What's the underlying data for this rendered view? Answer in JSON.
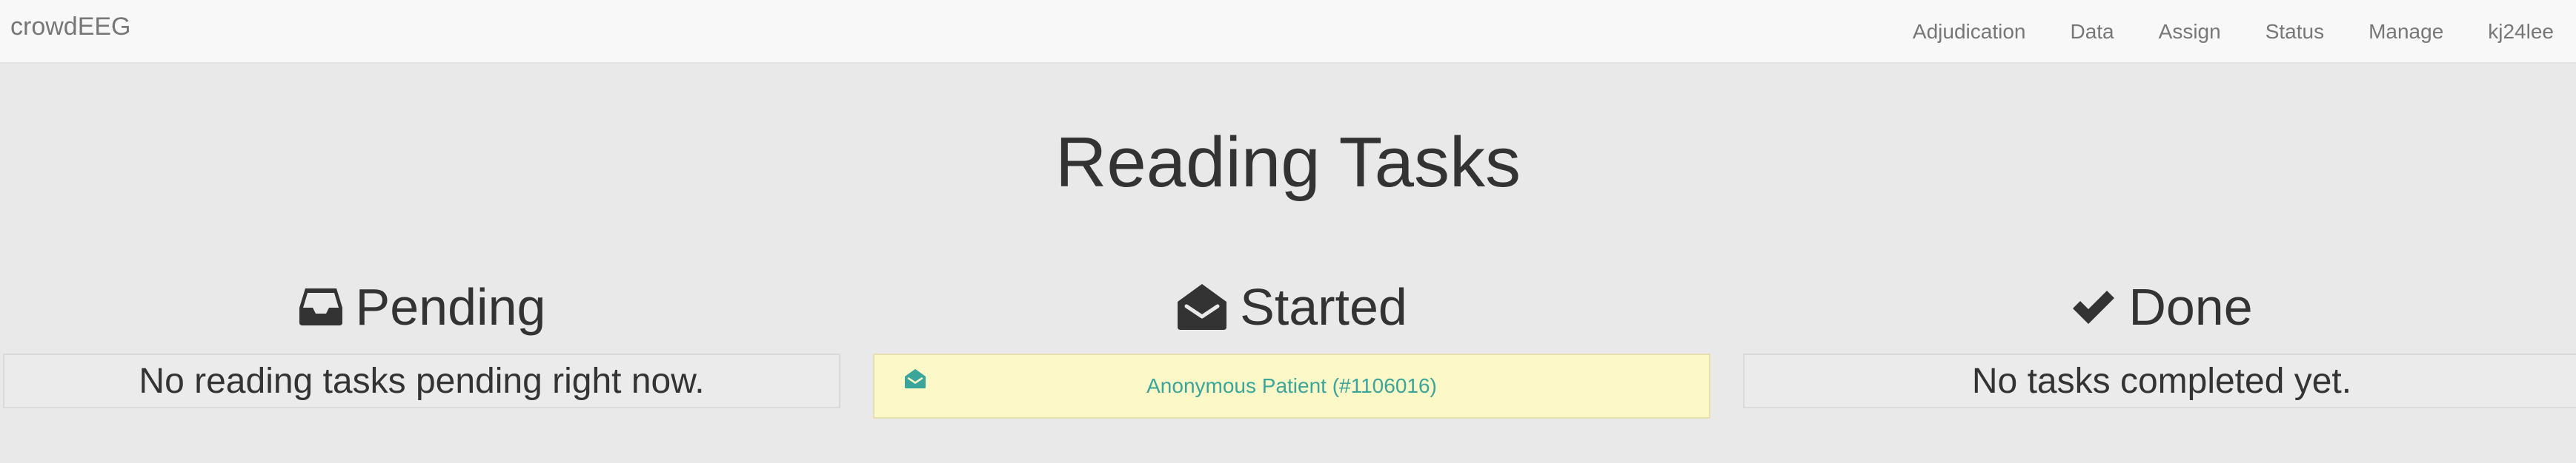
{
  "navbar": {
    "brand": "crowdEEG",
    "links": [
      {
        "label": "Adjudication"
      },
      {
        "label": "Data"
      },
      {
        "label": "Assign"
      },
      {
        "label": "Status"
      },
      {
        "label": "Manage"
      },
      {
        "label": "kj24lee"
      }
    ]
  },
  "page": {
    "title": "Reading Tasks"
  },
  "columns": {
    "pending": {
      "heading": "Pending",
      "icon": "inbox-icon",
      "empty_message": "No reading tasks pending right now."
    },
    "started": {
      "heading": "Started",
      "icon": "envelope-open-icon",
      "tasks": [
        {
          "label": "Anonymous Patient (#1106016)",
          "icon": "envelope-open-icon"
        }
      ]
    },
    "done": {
      "heading": "Done",
      "icon": "check-icon",
      "empty_message": "No tasks completed yet."
    }
  },
  "colors": {
    "navbar_bg": "#f8f8f8",
    "page_bg": "#e9e9e9",
    "task_highlight": "#fcf8c8",
    "link_teal": "#3aa59a"
  }
}
